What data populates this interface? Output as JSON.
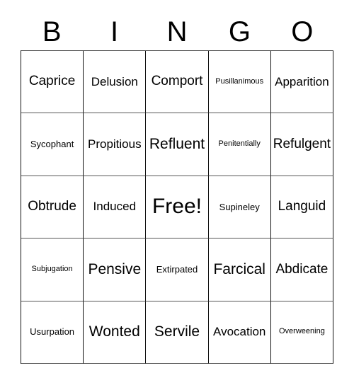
{
  "card": {
    "title": "BINGO",
    "free_space_label": "Free!",
    "header": {
      "letters": [
        "B",
        "I",
        "N",
        "G",
        "O"
      ]
    },
    "columns": 5,
    "rows": 5,
    "colors": {
      "background": "#ffffff",
      "text": "#000000",
      "grid_line": "#111111",
      "grid_line_light": "#555555"
    },
    "cells": [
      [
        {
          "text": "Caprice",
          "size": "lg"
        },
        {
          "text": "Delusion",
          "size": "md"
        },
        {
          "text": "Comport",
          "size": "lg"
        },
        {
          "text": "Pusillanimous",
          "size": "xs"
        },
        {
          "text": "Apparition",
          "size": "md"
        }
      ],
      [
        {
          "text": "Sycophant",
          "size": "sm"
        },
        {
          "text": "Propitious",
          "size": "md"
        },
        {
          "text": "Refluent",
          "size": "xl"
        },
        {
          "text": "Penitentially",
          "size": "xs"
        },
        {
          "text": "Refulgent",
          "size": "lg"
        }
      ],
      [
        {
          "text": "Obtrude",
          "size": "lg"
        },
        {
          "text": "Induced",
          "size": "md"
        },
        {
          "text": "Free!",
          "size": "xxl"
        },
        {
          "text": "Supineley",
          "size": "sm"
        },
        {
          "text": "Languid",
          "size": "lg"
        }
      ],
      [
        {
          "text": "Subjugation",
          "size": "xs"
        },
        {
          "text": "Pensive",
          "size": "xl"
        },
        {
          "text": "Extirpated",
          "size": "sm"
        },
        {
          "text": "Farcical",
          "size": "xl"
        },
        {
          "text": "Abdicate",
          "size": "lg"
        }
      ],
      [
        {
          "text": "Usurpation",
          "size": "sm"
        },
        {
          "text": "Wonted",
          "size": "xl"
        },
        {
          "text": "Servile",
          "size": "xl"
        },
        {
          "text": "Avocation",
          "size": "md"
        },
        {
          "text": "Overweening",
          "size": "xs"
        }
      ]
    ]
  }
}
